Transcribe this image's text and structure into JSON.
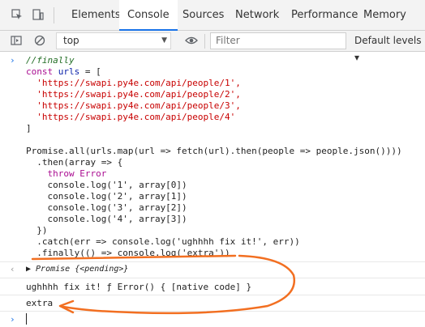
{
  "tabs": [
    "Elements",
    "Console",
    "Sources",
    "Network",
    "Performance",
    "Memory"
  ],
  "toolbar": {
    "context": "top",
    "filter_placeholder": "Filter",
    "levels": "Default levels ▾"
  },
  "code": [
    "//finally",
    "const urls = [",
    "  'https://swapi.py4e.com/api/people/1',",
    "  'https://swapi.py4e.com/api/people/2',",
    "  'https://swapi.py4e.com/api/people/3',",
    "  'https://swapi.py4e.com/api/people/4'",
    "]",
    "",
    "Promise.all(urls.map(url => fetch(url).then(people => people.json())))",
    "  .then(array => {",
    "    throw Error",
    "    console.log('1', array[0])",
    "    console.log('2', array[1])",
    "    console.log('3', array[2])",
    "    console.log('4', array[3])",
    "  })",
    "  .catch(err => console.log('ughhhh fix it!', err))",
    "  .finally(() => console.log('extra'))"
  ],
  "results": {
    "promise": "▶ Promise {<pending>}",
    "error_log": "ughhhh fix it! ƒ Error() { [native code] }",
    "extra": "extra"
  },
  "annotation_color": "#f26f21"
}
